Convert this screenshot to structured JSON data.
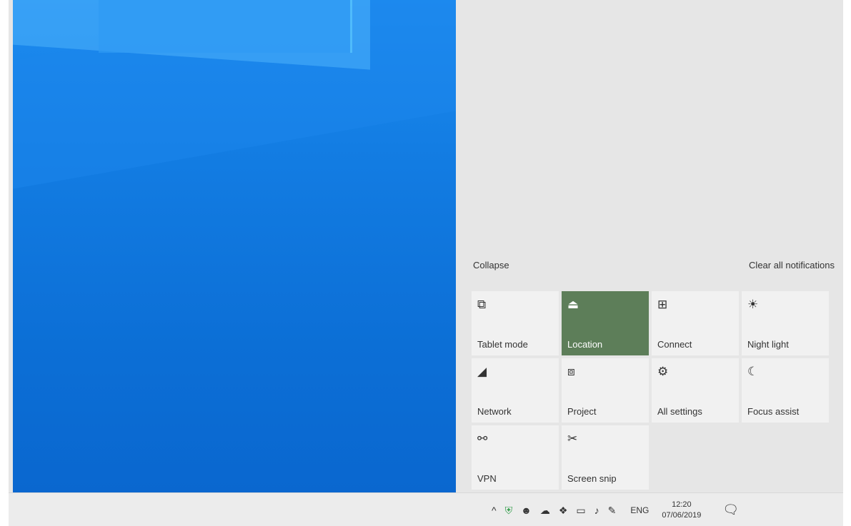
{
  "action_center": {
    "collapse": "Collapse",
    "clear_all": "Clear all notifications",
    "tiles": [
      {
        "label": "Tablet mode",
        "icon": "tablet-mode-icon",
        "active": false
      },
      {
        "label": "Location",
        "icon": "location-icon",
        "active": true
      },
      {
        "label": "Connect",
        "icon": "connect-icon",
        "active": false
      },
      {
        "label": "Night light",
        "icon": "night-light-icon",
        "active": false
      },
      {
        "label": "Network",
        "icon": "network-icon",
        "active": false
      },
      {
        "label": "Project",
        "icon": "project-icon",
        "active": false
      },
      {
        "label": "All settings",
        "icon": "settings-icon",
        "active": false
      },
      {
        "label": "Focus assist",
        "icon": "focus-assist-icon",
        "active": false
      },
      {
        "label": "VPN",
        "icon": "vpn-icon",
        "active": false
      },
      {
        "label": "Screen snip",
        "icon": "screen-snip-icon",
        "active": false
      }
    ],
    "active_color": "#5d7e59"
  },
  "taskbar": {
    "tray_icons": [
      "chevron-up-icon",
      "security-shield-icon",
      "people-icon",
      "onedrive-cloud-icon",
      "dropbox-icon",
      "display-icon",
      "volume-icon",
      "pen-icon"
    ],
    "language": "ENG",
    "time": "12:20",
    "date": "07/06/2019"
  },
  "desktop": {
    "accent": "#0c6fd6"
  }
}
